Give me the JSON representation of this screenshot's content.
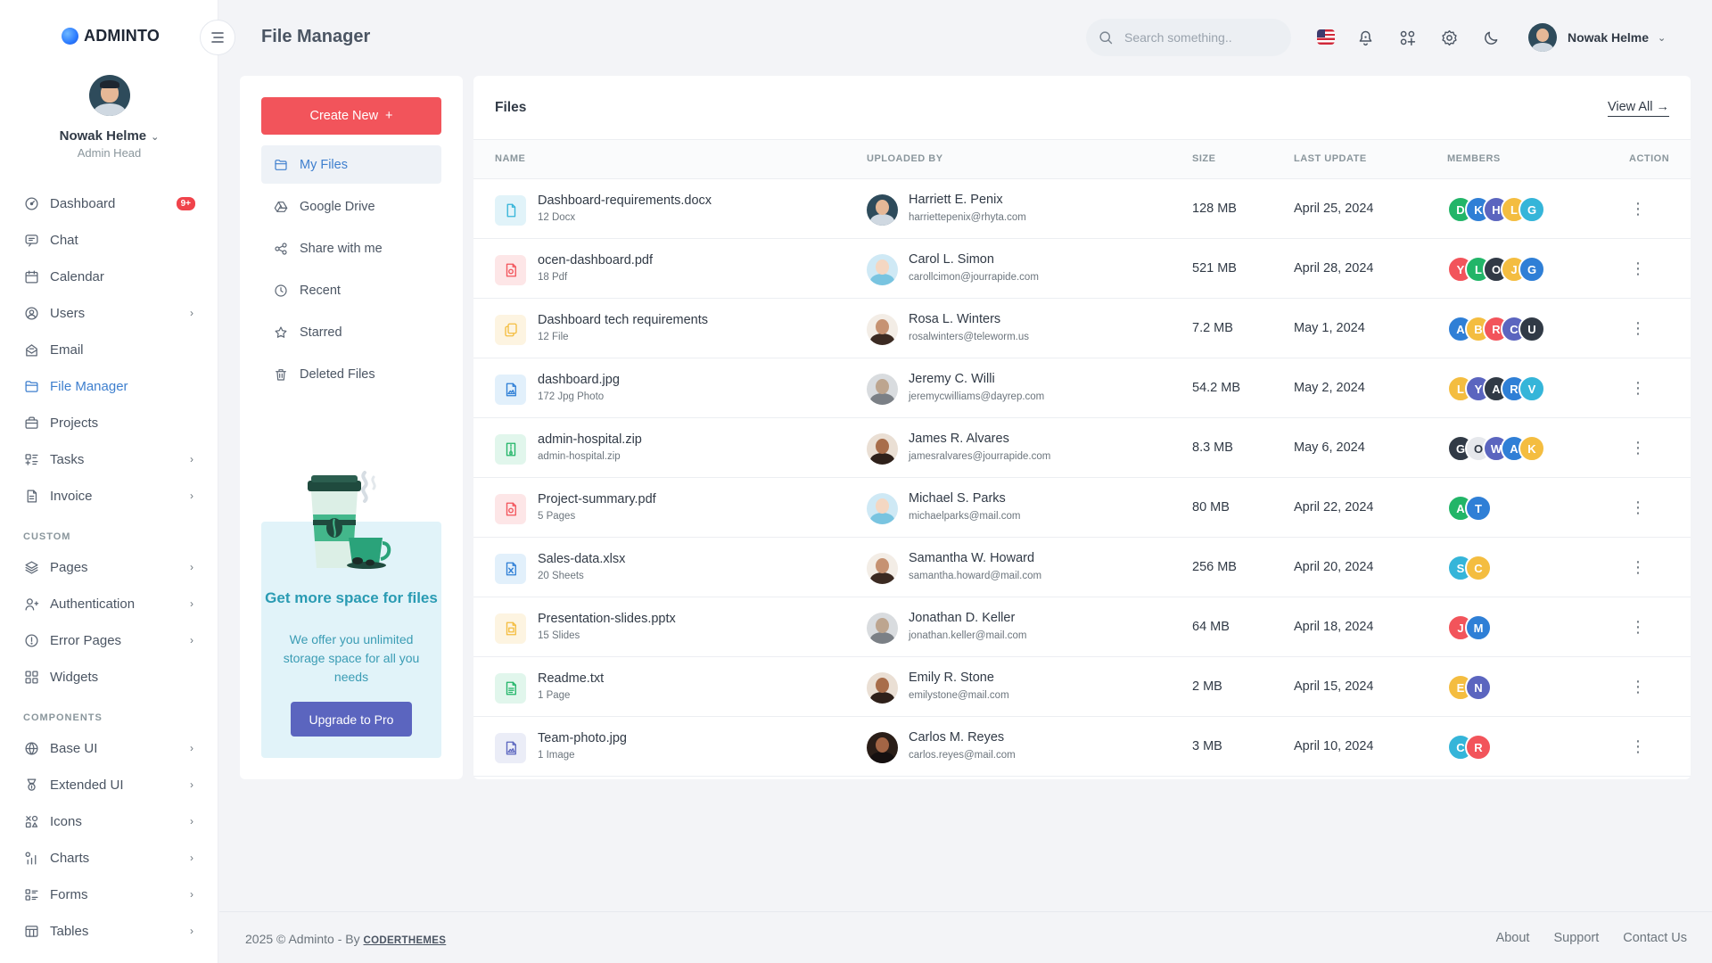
{
  "brand": {
    "name": "ADMINTO"
  },
  "sidebar": {
    "user": {
      "name": "Nowak Helme",
      "role": "Admin Head"
    },
    "items": [
      {
        "label": "Dashboard",
        "icon": "dashboard-icon",
        "badge": "9+"
      },
      {
        "label": "Chat",
        "icon": "chat-icon"
      },
      {
        "label": "Calendar",
        "icon": "calendar-icon"
      },
      {
        "label": "Users",
        "icon": "user-icon",
        "arrow": true
      },
      {
        "label": "Email",
        "icon": "email-icon"
      },
      {
        "label": "File Manager",
        "icon": "folder-icon",
        "active": true
      },
      {
        "label": "Projects",
        "icon": "briefcase-icon"
      },
      {
        "label": "Tasks",
        "icon": "tasks-icon",
        "arrow": true
      },
      {
        "label": "Invoice",
        "icon": "invoice-icon",
        "arrow": true
      }
    ],
    "custom_title": "CUSTOM",
    "custom_items": [
      {
        "label": "Pages",
        "icon": "pages-icon",
        "arrow": true
      },
      {
        "label": "Authentication",
        "icon": "auth-icon",
        "arrow": true
      },
      {
        "label": "Error Pages",
        "icon": "error-icon",
        "arrow": true
      },
      {
        "label": "Widgets",
        "icon": "widgets-icon"
      }
    ],
    "components_title": "COMPONENTS",
    "components_items": [
      {
        "label": "Base UI",
        "icon": "base-ui-icon",
        "arrow": true
      },
      {
        "label": "Extended UI",
        "icon": "extended-ui-icon",
        "arrow": true
      },
      {
        "label": "Icons",
        "icon": "icons-icon",
        "arrow": true
      },
      {
        "label": "Charts",
        "icon": "charts-icon",
        "arrow": true
      },
      {
        "label": "Forms",
        "icon": "forms-icon",
        "arrow": true
      },
      {
        "label": "Tables",
        "icon": "tables-icon",
        "arrow": true
      }
    ]
  },
  "topbar": {
    "title": "File Manager",
    "search_placeholder": "Search something..",
    "user_name": "Nowak Helme"
  },
  "file_nav": {
    "create_label": "Create New",
    "items": [
      {
        "label": "My Files",
        "icon": "folder-icon",
        "active": true
      },
      {
        "label": "Google Drive",
        "icon": "google-drive-icon"
      },
      {
        "label": "Share with me",
        "icon": "share-icon"
      },
      {
        "label": "Recent",
        "icon": "clock-icon"
      },
      {
        "label": "Starred",
        "icon": "star-icon"
      },
      {
        "label": "Deleted Files",
        "icon": "trash-icon"
      }
    ],
    "promo": {
      "title": "Get more space for files",
      "text": "We offer you unlimited storage space for all you needs",
      "button": "Upgrade to Pro"
    }
  },
  "files": {
    "title": "Files",
    "view_all": "View All",
    "columns": [
      "NAME",
      "UPLOADED BY",
      "SIZE",
      "LAST UPDATE",
      "MEMBERS",
      "ACTION"
    ],
    "rows": [
      {
        "name": "Dashboard-requirements.docx",
        "sub": "12 Docx",
        "type": "doc",
        "user": "Harriett E. Penix",
        "email": "harriettepenix@rhyta.com",
        "size": "128 MB",
        "date": "April 25, 2024",
        "members": [
          "D",
          "K",
          "H",
          "L",
          "G"
        ],
        "member_colors": [
          "#22b568",
          "#2f7fd6",
          "#5b65bf",
          "#f4bd40",
          "#35b5d9"
        ]
      },
      {
        "name": "ocen-dashboard.pdf",
        "sub": "18 Pdf",
        "type": "pdf",
        "user": "Carol L. Simon",
        "email": "carollcimon@jourrapide.com",
        "size": "521 MB",
        "date": "April 28, 2024",
        "members": [
          "Y",
          "L",
          "O",
          "J",
          "G"
        ],
        "member_colors": [
          "#f2545b",
          "#22b568",
          "#313a46",
          "#f4bd40",
          "#2f7fd6"
        ]
      },
      {
        "name": "Dashboard tech requirements",
        "sub": "12 File",
        "type": "file",
        "user": "Rosa L. Winters",
        "email": "rosalwinters@teleworm.us",
        "size": "7.2 MB",
        "date": "May 1, 2024",
        "members": [
          "A",
          "B",
          "R",
          "C",
          "U"
        ],
        "member_colors": [
          "#2f7fd6",
          "#f4bd40",
          "#f2545b",
          "#5b65bf",
          "#313a46"
        ]
      },
      {
        "name": "dashboard.jpg",
        "sub": "172 Jpg Photo",
        "type": "image",
        "user": "Jeremy C. Willi",
        "email": "jeremycwilliams@dayrep.com",
        "size": "54.2 MB",
        "date": "May 2, 2024",
        "members": [
          "L",
          "Y",
          "A",
          "R",
          "V"
        ],
        "member_colors": [
          "#f4bd40",
          "#5b65bf",
          "#313a46",
          "#2f7fd6",
          "#35b5d9"
        ]
      },
      {
        "name": "admin-hospital.zip",
        "sub": "admin-hospital.zip",
        "type": "zip",
        "user": "James R. Alvares",
        "email": "jamesralvares@jourrapide.com",
        "size": "8.3 MB",
        "date": "May 6, 2024",
        "members": [
          "G",
          "O",
          "W",
          "A",
          "K"
        ],
        "member_colors": [
          "#313a46",
          "#e6e8ec",
          "#5b65bf",
          "#2f7fd6",
          "#f4bd40"
        ]
      },
      {
        "name": "Project-summary.pdf",
        "sub": "5 Pages",
        "type": "pdf",
        "user": "Michael S. Parks",
        "email": "michaelparks@mail.com",
        "size": "80 MB",
        "date": "April 22, 2024",
        "members": [
          "A",
          "T"
        ],
        "member_colors": [
          "#22b568",
          "#2f7fd6"
        ]
      },
      {
        "name": "Sales-data.xlsx",
        "sub": "20 Sheets",
        "type": "xls",
        "user": "Samantha W. Howard",
        "email": "samantha.howard@mail.com",
        "size": "256 MB",
        "date": "April 20, 2024",
        "members": [
          "S",
          "C"
        ],
        "member_colors": [
          "#35b5d9",
          "#f4bd40"
        ]
      },
      {
        "name": "Presentation-slides.pptx",
        "sub": "15 Slides",
        "type": "ppt",
        "user": "Jonathan D. Keller",
        "email": "jonathan.keller@mail.com",
        "size": "64 MB",
        "date": "April 18, 2024",
        "members": [
          "J",
          "M"
        ],
        "member_colors": [
          "#f2545b",
          "#2f7fd6"
        ]
      },
      {
        "name": "Readme.txt",
        "sub": "1 Page",
        "type": "txt",
        "user": "Emily R. Stone",
        "email": "emilystone@mail.com",
        "size": "2 MB",
        "date": "April 15, 2024",
        "members": [
          "E",
          "N"
        ],
        "member_colors": [
          "#f4bd40",
          "#5b65bf"
        ]
      },
      {
        "name": "Team-photo.jpg",
        "sub": "1 Image",
        "type": "photo",
        "user": "Carlos M. Reyes",
        "email": "carlos.reyes@mail.com",
        "size": "3 MB",
        "date": "April 10, 2024",
        "members": [
          "C",
          "R"
        ],
        "member_colors": [
          "#35b5d9",
          "#f2545b"
        ]
      }
    ]
  },
  "footer": {
    "copyright": "2025 © Adminto - By",
    "brand": "CODERTHEMES",
    "links": [
      "About",
      "Support",
      "Contact Us"
    ]
  }
}
